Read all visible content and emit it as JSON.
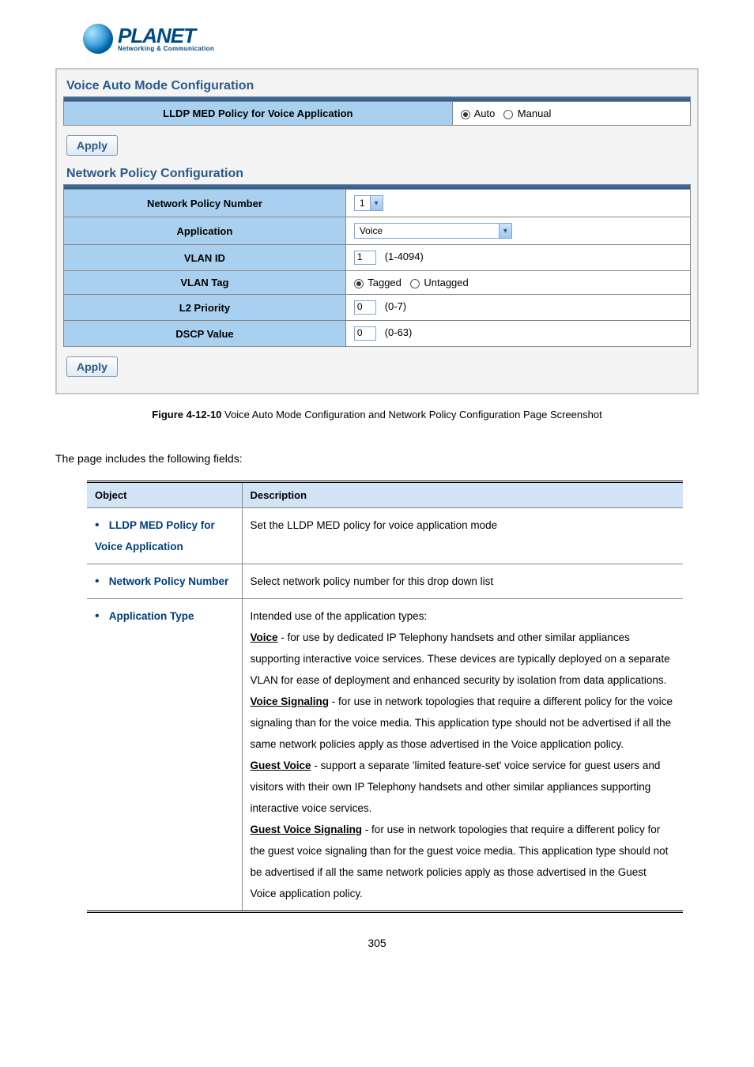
{
  "logo": {
    "brand": "PLANET",
    "tagline": "Networking & Communication"
  },
  "panel": {
    "section1_title": "Voice Auto Mode Configuration",
    "row1_label": "LLDP MED Policy for Voice Application",
    "row1_opt1": "Auto",
    "row1_opt2": "Manual",
    "apply1": "Apply",
    "section2_title": "Network Policy Configuration",
    "rows": {
      "npn_label": "Network Policy Number",
      "npn_value": "1",
      "app_label": "Application",
      "app_value": "Voice",
      "vlanid_label": "VLAN ID",
      "vlanid_value": "1",
      "vlanid_hint": "(1-4094)",
      "vtag_label": "VLAN Tag",
      "vtag_opt1": "Tagged",
      "vtag_opt2": "Untagged",
      "l2p_label": "L2 Priority",
      "l2p_value": "0",
      "l2p_hint": "(0-7)",
      "dscp_label": "DSCP Value",
      "dscp_value": "0",
      "dscp_hint": "(0-63)"
    },
    "apply2": "Apply"
  },
  "figure_caption_bold": "Figure 4-12-10",
  "figure_caption_rest": " Voice Auto Mode Configuration and Network Policy Configuration Page Screenshot",
  "intro": "The page includes the following fields:",
  "table": {
    "h1": "Object",
    "h2": "Description",
    "r1_obj": "LLDP MED Policy for Voice Application",
    "r1_desc": "Set the LLDP MED policy for voice application mode",
    "r2_obj": "Network Policy Number",
    "r2_desc": "Select network policy number for this drop down list",
    "r3_obj": "Application Type",
    "r3_intro": "Intended use of the application types:",
    "r3_voice_b": "Voice",
    "r3_voice_t": " - for use by dedicated IP Telephony handsets and other similar appliances supporting interactive voice services. These devices are typically deployed on a separate VLAN for ease of deployment and enhanced security by isolation from data applications.",
    "r3_vs_b": "Voice Signaling",
    "r3_vs_t": " - for use in network topologies that require a different policy for the voice signaling than for the voice media. This application type should not be advertised if all the same network policies apply as those advertised in the Voice application policy.",
    "r3_gv_b": "Guest Voice",
    "r3_gv_t": " - support a separate 'limited feature-set' voice service for guest users and visitors with their own IP Telephony handsets and other similar appliances supporting interactive voice services.",
    "r3_gvs_b": "Guest Voice Signaling",
    "r3_gvs_t": " - for use in network topologies that require a different policy for the guest voice signaling than for the guest voice media. This application type should not be advertised if all the same network policies apply as those advertised in the Guest Voice application policy."
  },
  "page_number": "305"
}
